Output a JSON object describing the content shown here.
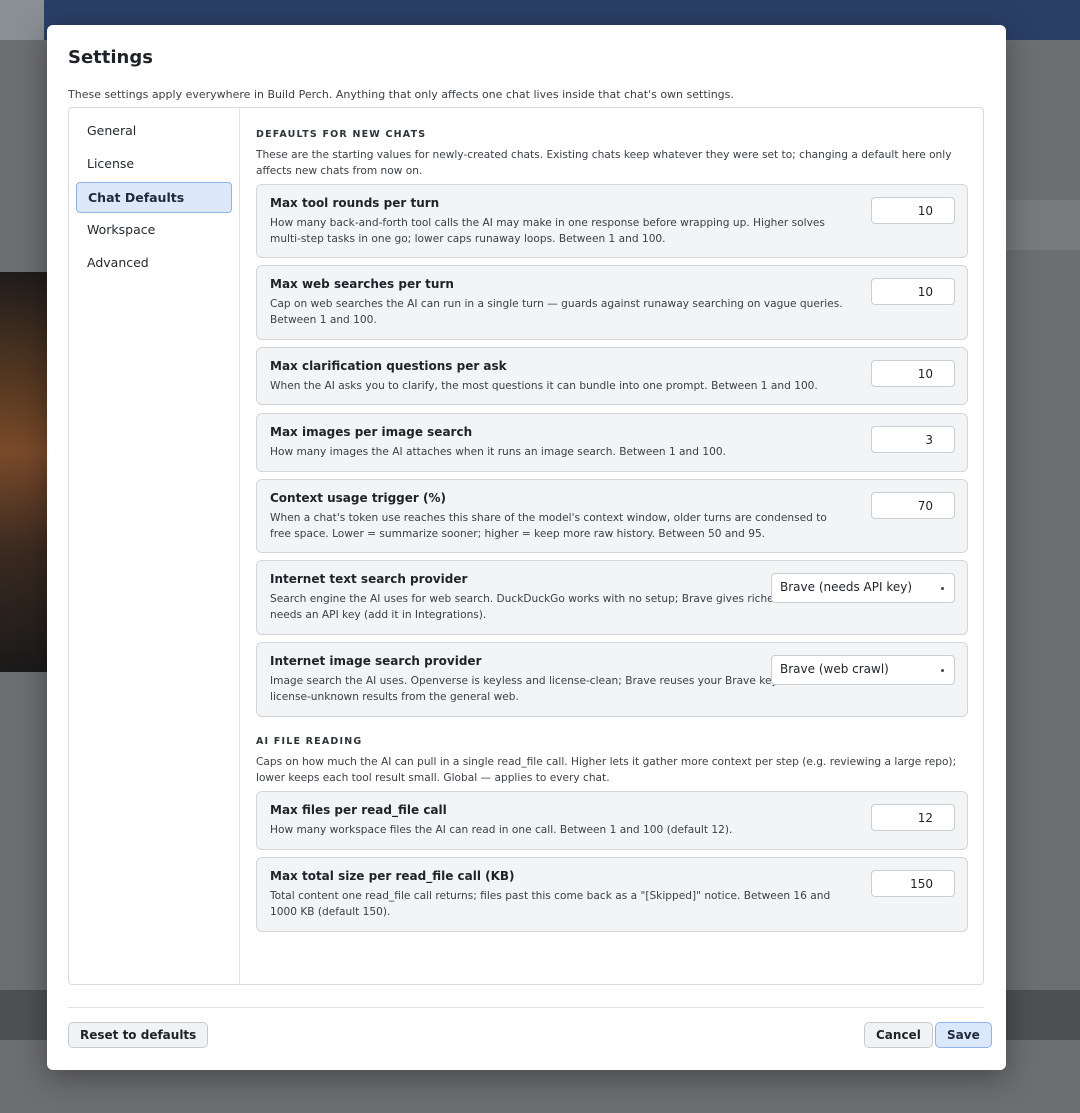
{
  "dialog": {
    "title": "Settings",
    "subtitle": "These settings apply everywhere in Build Perch. Anything that only affects one chat lives inside that chat's own settings."
  },
  "nav": {
    "items": [
      {
        "label": "General",
        "active": false
      },
      {
        "label": "License",
        "active": false
      },
      {
        "label": "Chat Defaults",
        "active": true
      },
      {
        "label": "Workspace",
        "active": false
      },
      {
        "label": "Advanced",
        "active": false
      }
    ]
  },
  "sections": {
    "new_chats": {
      "heading": "DEFAULTS FOR NEW CHATS",
      "description": "These are the starting values for newly-created chats. Existing chats keep whatever they were set to; changing a default here only affects new chats from now on.",
      "settings": [
        {
          "title": "Max tool rounds per turn",
          "description": "How many back-and-forth tool calls the AI may make in one response before wrapping up. Higher solves multi-step tasks in one go; lower caps runaway loops. Between 1 and 100.",
          "value": "10"
        },
        {
          "title": "Max web searches per turn",
          "description": "Cap on web searches the AI can run in a single turn — guards against runaway searching on vague queries. Between 1 and 100.",
          "value": "10"
        },
        {
          "title": "Max clarification questions per ask",
          "description": "When the AI asks you to clarify, the most questions it can bundle into one prompt. Between 1 and 100.",
          "value": "10"
        },
        {
          "title": "Max images per image search",
          "description": "How many images the AI attaches when it runs an image search. Between 1 and 100.",
          "value": "3"
        },
        {
          "title": "Context usage trigger (%)",
          "description": "When a chat's token use reaches this share of the model's context window, older turns are condensed to free space. Lower = summarize sooner; higher = keep more raw history. Between 50 and 95.",
          "value": "70"
        },
        {
          "title": "Internet text search provider",
          "description": "Search engine the AI uses for web search. DuckDuckGo works with no setup; Brave gives richer results but needs an API key (add it in Integrations).",
          "selected": "Brave (needs API key)"
        },
        {
          "title": "Internet image search provider",
          "description": "Image search the AI uses. Openverse is keyless and license-clean; Brave reuses your Brave key and returns license-unknown results from the general web.",
          "selected": "Brave (web crawl)"
        }
      ]
    },
    "file_reading": {
      "heading": "AI FILE READING",
      "description": "Caps on how much the AI can pull in a single read_file call. Higher lets it gather more context per step (e.g. reviewing a large repo); lower keeps each tool result small. Global — applies to every chat.",
      "settings": [
        {
          "title": "Max files per read_file call",
          "description": "How many workspace files the AI can read in one call. Between 1 and 100 (default 12).",
          "value": "12"
        },
        {
          "title": "Max total size per read_file call (KB)",
          "description": "Total content one read_file call returns; files past this come back as a \"[Skipped]\" notice. Between 16 and 1000 KB (default 150).",
          "value": "150"
        }
      ]
    }
  },
  "footer": {
    "reset_label": "Reset to defaults",
    "cancel_label": "Cancel",
    "save_label": "Save"
  }
}
